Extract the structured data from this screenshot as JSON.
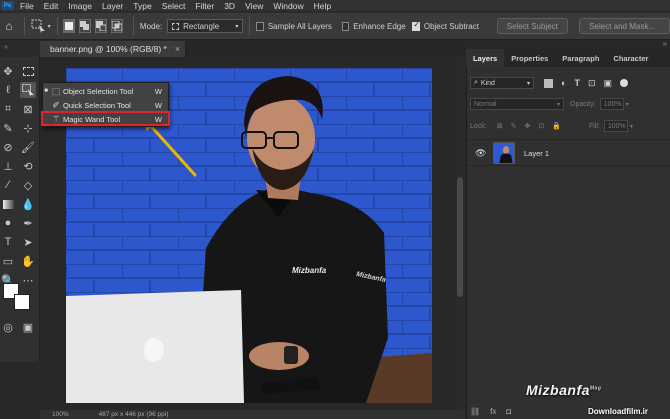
{
  "app": {
    "logo_text": "Ps"
  },
  "menubar": {
    "items": [
      "File",
      "Edit",
      "Image",
      "Layer",
      "Type",
      "Select",
      "Filter",
      "3D",
      "View",
      "Window",
      "Help"
    ]
  },
  "options_bar": {
    "mode_label": "Mode:",
    "mode_value": "Rectangle",
    "sample_all_layers": "Sample All Layers",
    "enhance_edge": "Enhance Edge",
    "object_subtract": "Object Subtract",
    "select_subject": "Select Subject",
    "select_and_mask": "Select and Mask..."
  },
  "document": {
    "tab_title": "banner.png @ 100% (RGB/8) *",
    "close_glyph": "×",
    "canvas_logo_text": "Mizbanfa",
    "shirt_logo_text": "Mizbanfa"
  },
  "tool_flyout": {
    "items": [
      {
        "label": "Object Selection Tool",
        "shortcut": "W",
        "active": true
      },
      {
        "label": "Quick Selection Tool",
        "shortcut": "W",
        "active": false
      },
      {
        "label": "Magic Wand Tool",
        "shortcut": "W",
        "active": false,
        "highlighted": true
      }
    ]
  },
  "status_bar": {
    "zoom": "100%",
    "dimensions": "487 px x 446 px (96 ppi)"
  },
  "panel": {
    "tabs": [
      "Layers",
      "Properties",
      "Paragraph",
      "Character"
    ],
    "active_tab": "Layers",
    "filter_kind": "Kind",
    "blend_mode": "Normal",
    "opacity_label": "Opacity:",
    "opacity_value": "100%",
    "lock_label": "Lock:",
    "fill_label": "Fill:",
    "fill_value": "100%",
    "layers": [
      {
        "name": "Layer 1",
        "visible": true
      }
    ],
    "bottom_icons": [
      "link-icon",
      "fx-icon",
      "mask-icon"
    ]
  },
  "watermark": {
    "brand": "Mizbanfa",
    "brand_sup": "Mag",
    "site": "Downloadfilm.ir"
  },
  "colors": {
    "highlight": "#e0242a",
    "arrow": "#f0b400",
    "canvas_bg": "#2f5ad0"
  }
}
